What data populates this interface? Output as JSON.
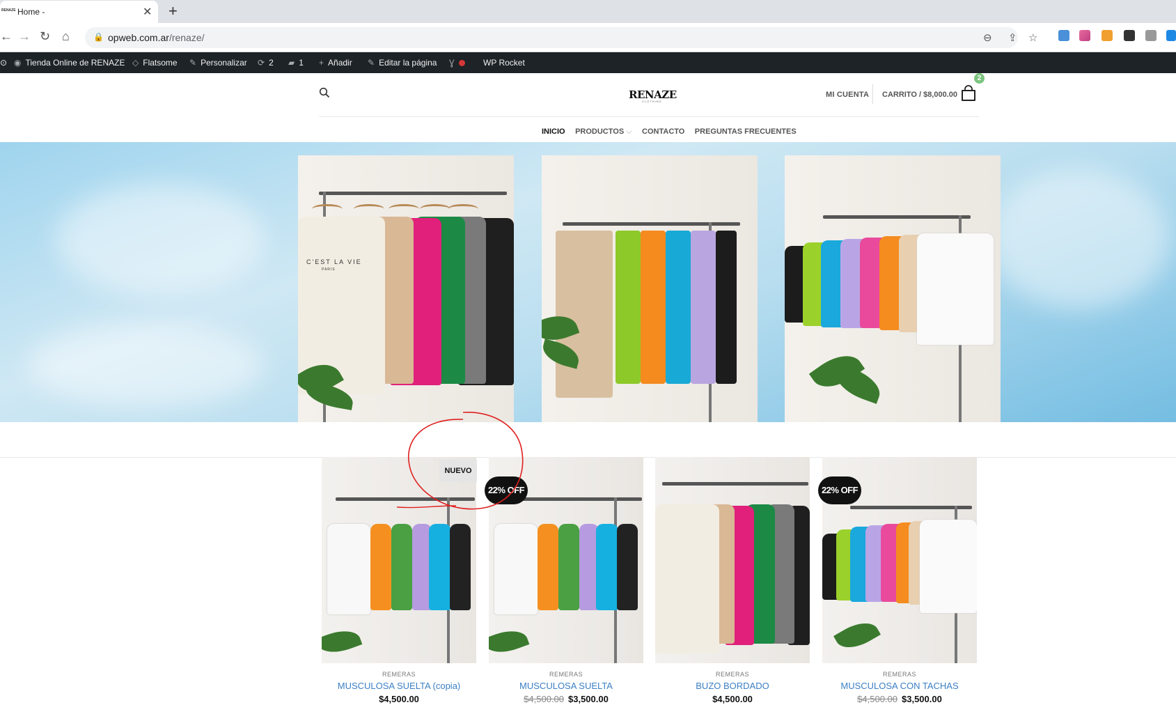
{
  "browser": {
    "tab_title": "Home -",
    "tab_favicon_text": "RENAZE",
    "url_host": "opweb.com.ar",
    "url_path": "/renaze/"
  },
  "adminbar": {
    "site": "Tienda Online de RENAZE",
    "theme": "Flatsome",
    "customize": "Personalizar",
    "updates": "2",
    "comments": "1",
    "add": "Añadir",
    "edit": "Editar la página",
    "rocket": "WP Rocket"
  },
  "header": {
    "logo": "RENAZE",
    "logo_sub": "CLOTHING",
    "account": "MI CUENTA",
    "cart": "CARRITO / $8,000.00",
    "cart_count": "2"
  },
  "nav": {
    "items": [
      {
        "label": "INICIO",
        "active": true
      },
      {
        "label": "PRODUCTOS"
      },
      {
        "label": "CONTACTO"
      },
      {
        "label": "PREGUNTAS FRECUENTES"
      }
    ],
    "dropdown_indicator": "⌵"
  },
  "hero": {
    "photo1_print": "C'EST LA VIE",
    "photo1_print_sub": "PARIS"
  },
  "products": [
    {
      "category": "REMERAS",
      "name": "MUSCULOSA SUELTA (copia)",
      "price": "$4,500.00",
      "old_price": "",
      "badge": "NUEVO"
    },
    {
      "category": "REMERAS",
      "name": "MUSCULOSA SUELTA",
      "price": "$3,500.00",
      "old_price": "$4,500.00",
      "badge": "22% OFF"
    },
    {
      "category": "REMERAS",
      "name": "BUZO BORDADO",
      "price": "$4,500.00",
      "old_price": "",
      "badge": ""
    },
    {
      "category": "REMERAS",
      "name": "MUSCULOSA CON TACHAS",
      "price": "$3,500.00",
      "old_price": "$4,500.00",
      "badge": "22% OFF"
    }
  ],
  "colors": {
    "admin_bar": "#1d2327",
    "link_blue": "#3b7fc4",
    "badge_green": "#7bc47f",
    "annotation_red": "#e02020"
  }
}
